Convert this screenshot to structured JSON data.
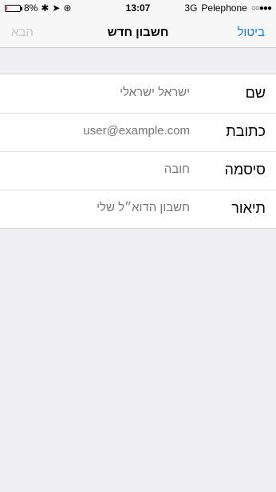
{
  "status": {
    "battery_percent_label": "8%",
    "battery_level": 0.08,
    "battery_color": "#e2001a",
    "time": "13:07",
    "network": "3G",
    "carrier": "Pelephone",
    "signal_dots": "○○●●●",
    "icons": [
      "bluetooth-icon",
      "location-icon",
      "lock-rotation-icon"
    ]
  },
  "nav": {
    "next_label": "הבא",
    "title": "חשבון חדש",
    "cancel_label": "ביטול",
    "accent_color": "#0a7aff"
  },
  "form": {
    "rows": [
      {
        "label": "שם",
        "placeholder": "ישראל ישראלי"
      },
      {
        "label": "כתובת",
        "placeholder": "user@example.com"
      },
      {
        "label": "סיסמה",
        "placeholder": "חובה"
      },
      {
        "label": "תיאור",
        "placeholder": "חשבון הדוא״ל שלי"
      }
    ]
  }
}
